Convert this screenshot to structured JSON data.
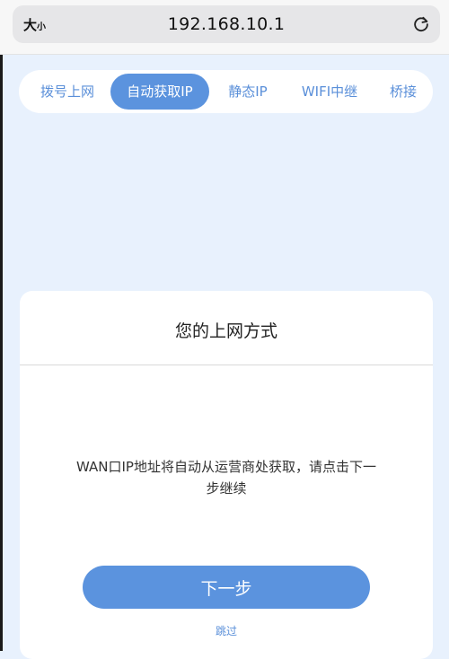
{
  "browser": {
    "text_size_big": "大",
    "text_size_small": "小",
    "url": "192.168.10.1"
  },
  "tabs": [
    {
      "label": "拨号上网",
      "active": false
    },
    {
      "label": "自动获取IP",
      "active": true
    },
    {
      "label": "静态IP",
      "active": false
    },
    {
      "label": "WIFI中继",
      "active": false
    },
    {
      "label": "桥接",
      "active": false
    }
  ],
  "card": {
    "title": "您的上网方式",
    "description": "WAN口IP地址将自动从运营商处获取，请点击下一步继续",
    "next_label": "下一步",
    "skip_label": "跳过"
  },
  "colors": {
    "accent": "#5b93de",
    "page_bg": "#e8f1fd"
  }
}
